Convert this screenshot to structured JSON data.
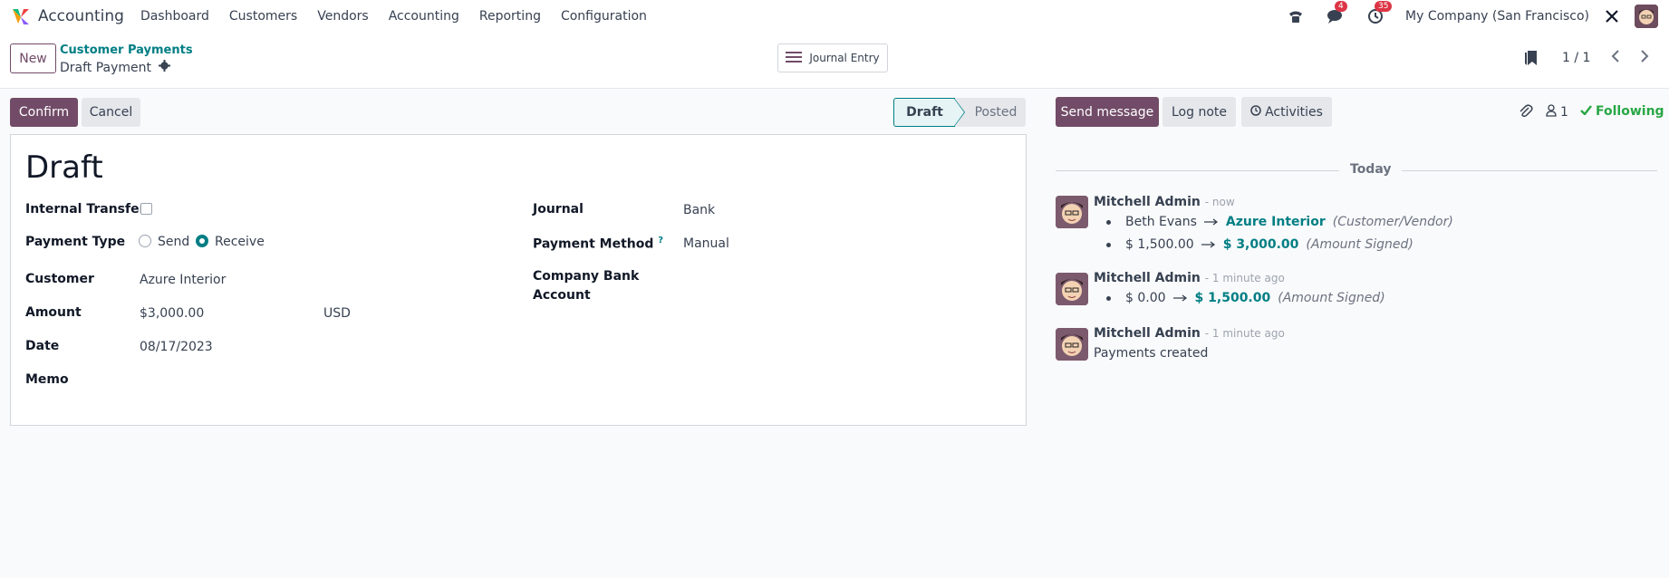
{
  "navbar": {
    "app_name": "Accounting",
    "menu": [
      "Dashboard",
      "Customers",
      "Vendors",
      "Accounting",
      "Reporting",
      "Configuration"
    ],
    "messages_badge": "4",
    "activities_badge": "35",
    "company": "My Company (San Francisco)"
  },
  "control": {
    "new_label": "New",
    "breadcrumb_parent": "Customer Payments",
    "breadcrumb_current": "Draft Payment",
    "journal_entry_label": "Journal Entry",
    "pager": "1 / 1"
  },
  "status": {
    "confirm_label": "Confirm",
    "cancel_label": "Cancel",
    "stages": [
      "Draft",
      "Posted"
    ]
  },
  "form": {
    "title": "Draft",
    "internal_transfer_label": "Internal Transfer",
    "payment_type_label": "Payment Type",
    "payment_type_send": "Send",
    "payment_type_receive": "Receive",
    "customer_label": "Customer",
    "customer_value": "Azure Interior",
    "amount_label": "Amount",
    "amount_value": "$3,000.00",
    "currency": "USD",
    "date_label": "Date",
    "date_value": "08/17/2023",
    "memo_label": "Memo",
    "journal_label": "Journal",
    "journal_value": "Bank",
    "payment_method_label": "Payment Method",
    "payment_method_help": "?",
    "payment_method_value": "Manual",
    "company_bank_label_1": "Company Bank",
    "company_bank_label_2": "Account"
  },
  "chatter": {
    "send_message_label": "Send message",
    "log_note_label": "Log note",
    "activities_label": "Activities",
    "followers_count": "1",
    "following_label": "Following",
    "today_label": "Today",
    "messages": [
      {
        "author": "Mitchell Admin",
        "time": "- now",
        "changes": [
          {
            "old": "Beth Evans",
            "new": "Azure Interior",
            "field": "(Customer/Vendor)"
          },
          {
            "old": "$ 1,500.00",
            "new": "$ 3,000.00",
            "field": "(Amount Signed)"
          }
        ]
      },
      {
        "author": "Mitchell Admin",
        "time": "- 1 minute ago",
        "changes": [
          {
            "old": "$ 0.00",
            "new": "$ 1,500.00",
            "field": "(Amount Signed)"
          }
        ]
      },
      {
        "author": "Mitchell Admin",
        "time": "- 1 minute ago",
        "body": "Payments created"
      }
    ]
  },
  "colors": {
    "brand": "#714b67",
    "accent": "#017e84",
    "following": "#28a745",
    "badge": "#dc3545"
  }
}
